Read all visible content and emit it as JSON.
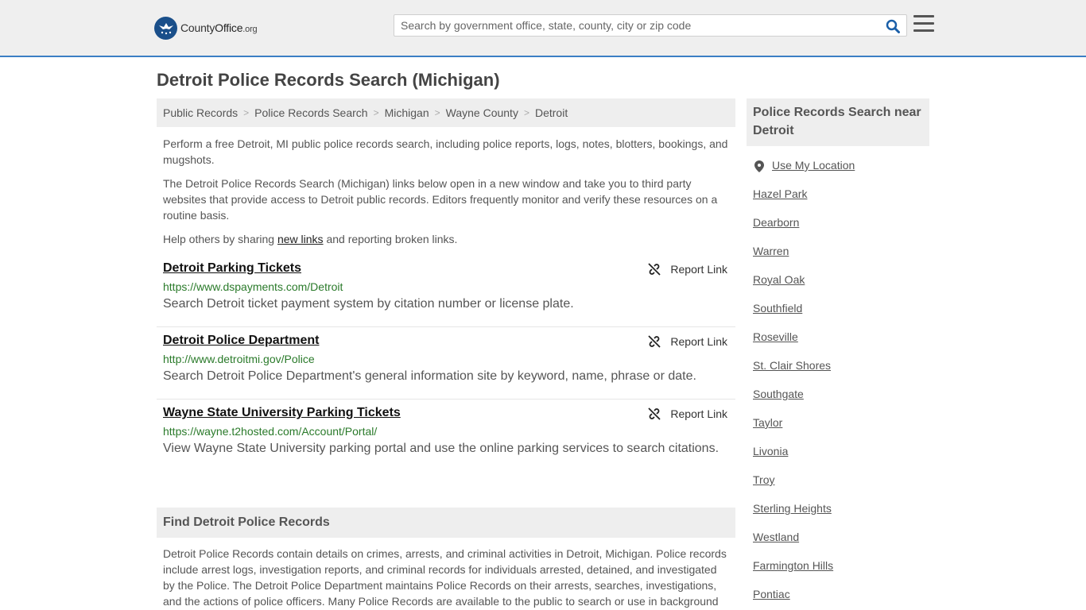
{
  "header": {
    "logo": {
      "name": "County",
      "name_bold": "Office",
      "tld": ".org"
    },
    "search": {
      "placeholder": "Search by government office, state, county, city or zip code"
    }
  },
  "page": {
    "title": "Detroit Police Records Search (Michigan)"
  },
  "breadcrumb": [
    "Public Records",
    "Police Records Search",
    "Michigan",
    "Wayne County",
    "Detroit"
  ],
  "intro": {
    "p1": "Perform a free Detroit, MI public police records search, including police reports, logs, notes, blotters, bookings, and mugshots.",
    "p2": "The Detroit Police Records Search (Michigan) links below open in a new window and take you to third party websites that provide access to Detroit public records. Editors frequently monitor and verify these resources on a routine basis.",
    "p3_before": "Help others by sharing ",
    "p3_link": "new links",
    "p3_after": " and reporting broken links."
  },
  "report_label": "Report Link",
  "results": [
    {
      "title": "Detroit Parking Tickets",
      "url": "https://www.dspayments.com/Detroit",
      "description": "Search Detroit ticket payment system by citation number or license plate."
    },
    {
      "title": "Detroit Police Department",
      "url": "http://www.detroitmi.gov/Police",
      "description": "Search Detroit Police Department's general information site by keyword, name, phrase or date."
    },
    {
      "title": "Wayne State University Parking Tickets",
      "url": "https://wayne.t2hosted.com/Account/Portal/",
      "description": "View Wayne State University parking portal and use the online parking services to search citations."
    }
  ],
  "find_section": {
    "heading": "Find Detroit Police Records",
    "body": "Detroit Police Records contain details on crimes, arrests, and criminal activities in Detroit, Michigan. Police records include arrest logs, investigation reports, and criminal records for individuals arrested, detained, and investigated by the Police. The Detroit Police Department maintains Police Records on their arrests, searches, investigations, and the actions of police officers. Many Police Records are available to the public to search or use in background checks."
  },
  "sidebar": {
    "heading": "Police Records Search near Detroit",
    "use_location": "Use My Location",
    "cities": [
      "Hazel Park",
      "Dearborn",
      "Warren",
      "Royal Oak",
      "Southfield",
      "Roseville",
      "St. Clair Shores",
      "Southgate",
      "Taylor",
      "Livonia",
      "Troy",
      "Sterling Heights",
      "Westland",
      "Farmington Hills",
      "Pontiac"
    ]
  },
  "colors": {
    "accent_border": "#3b7fc4",
    "logo_blue": "#1a4f8a",
    "url_green": "#2a7a2a"
  },
  "icons": {
    "search": "magnifier-icon",
    "menu": "hamburger-icon",
    "report": "broken-link-icon",
    "location": "map-pin-icon"
  }
}
